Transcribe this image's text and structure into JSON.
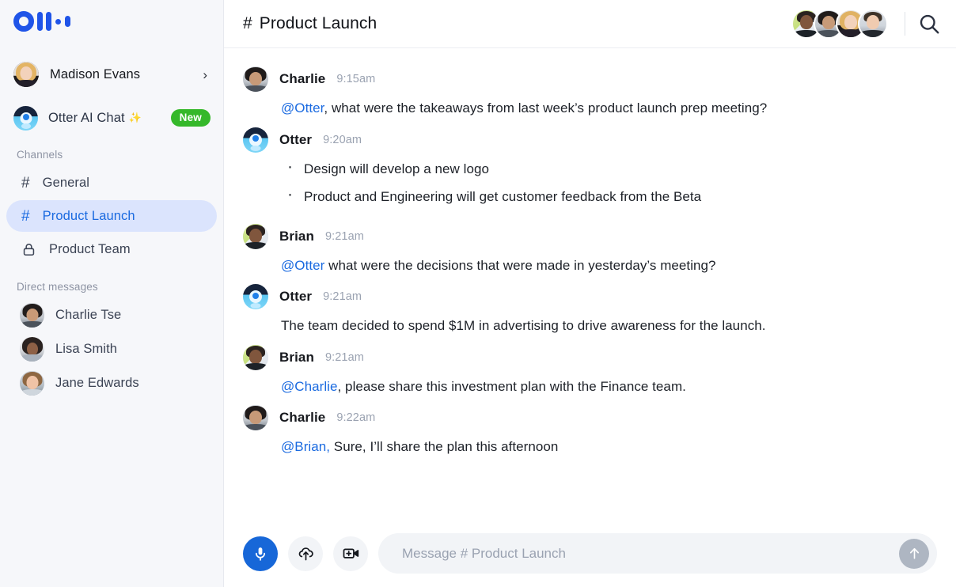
{
  "brand": {
    "logo_name": "otter-logo",
    "accent": "#1f54e8",
    "link": "#1a6ae0",
    "badge_green": "#35b82a",
    "active_bg": "#dbe4fd"
  },
  "sidebar": {
    "user": {
      "name": "Madison Evans",
      "chevron": "›",
      "avatar": "madison-avatar"
    },
    "otter_chat": {
      "label": "Otter AI Chat",
      "sparkle": "✨",
      "badge": "New"
    },
    "channels_label": "Channels",
    "channels": [
      {
        "label": "General",
        "icon": "hash-icon",
        "glyph": "#",
        "active": false
      },
      {
        "label": "Product Launch",
        "icon": "hash-icon",
        "glyph": "#",
        "active": true
      },
      {
        "label": "Product Team",
        "icon": "lock-icon",
        "glyph": "",
        "active": false
      }
    ],
    "dm_label": "Direct messages",
    "dms": [
      {
        "label": "Charlie Tse",
        "avatar": "charlie-avatar"
      },
      {
        "label": "Lisa Smith",
        "avatar": "lisa-avatar"
      },
      {
        "label": "Jane Edwards",
        "avatar": "jane-avatar"
      }
    ]
  },
  "header": {
    "hash": "#",
    "title": "Product Launch",
    "members": [
      "brian-avatar",
      "charlie-avatar",
      "madison-avatar",
      "dave-avatar"
    ],
    "search_icon": "search-icon"
  },
  "messages": [
    {
      "author": "Charlie",
      "time": "9:15am",
      "avatar": "charlie-avatar",
      "type": "text",
      "mention": "@Otter",
      "text": ", what were the takeaways from last week’s product launch prep meeting?"
    },
    {
      "author": "Otter",
      "time": "9:20am",
      "avatar": "otter-avatar",
      "type": "bullets",
      "bullets": [
        "Design will develop a new logo",
        "Product and Engineering will get customer feedback from the Beta"
      ]
    },
    {
      "author": "Brian",
      "time": "9:21am",
      "avatar": "brian-avatar",
      "type": "text",
      "mention": "@Otter",
      "text": " what were the decisions that were made in yesterday’s meeting?"
    },
    {
      "author": "Otter",
      "time": "9:21am",
      "avatar": "otter-avatar",
      "type": "text",
      "mention": "",
      "text": "The team decided to spend $1M in advertising to drive awareness for the launch."
    },
    {
      "author": "Brian",
      "time": "9:21am",
      "avatar": "brian-avatar",
      "type": "text",
      "mention": "@Charlie",
      "text": ", please share this investment plan with the Finance team."
    },
    {
      "author": "Charlie",
      "time": "9:22am",
      "avatar": "charlie-avatar",
      "type": "text",
      "mention": "@Brian,",
      "text": " Sure, I’ll share the plan this afternoon"
    }
  ],
  "composer": {
    "mic_icon": "microphone-icon",
    "upload_icon": "cloud-upload-icon",
    "video_icon": "add-video-icon",
    "placeholder": "Message # Product Launch",
    "value": "",
    "send_icon": "arrow-up-icon"
  }
}
